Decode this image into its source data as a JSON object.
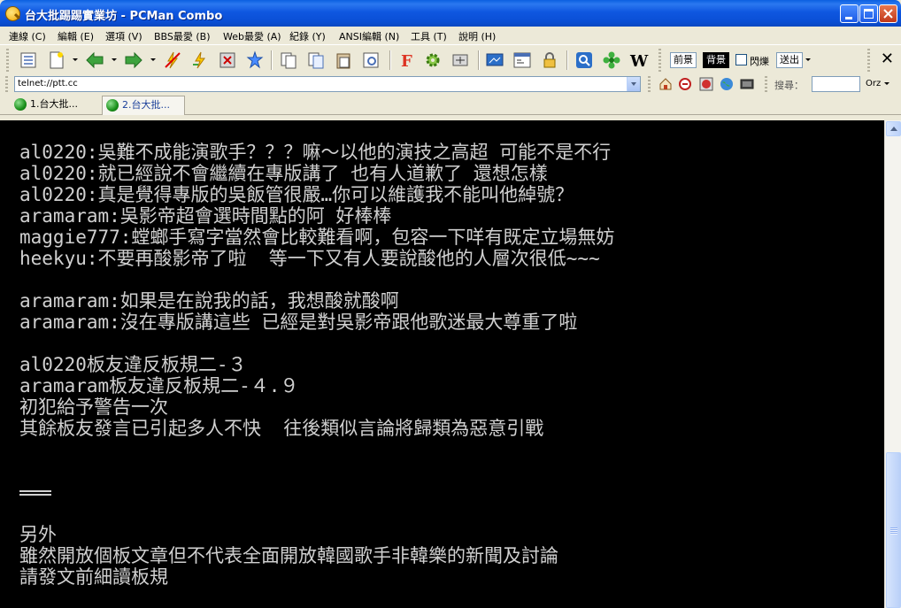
{
  "window": {
    "title": "台大批踢踢實業坊 - PCMan Combo"
  },
  "menu": [
    "連線 (C)",
    "編輯 (E)",
    "選項 (V)",
    "BBS最愛 (B)",
    "Web最愛 (A)",
    "紀錄 (Y)",
    "ANSI編輯 (N)",
    "工具 (T)",
    "說明 (H)"
  ],
  "toolbar": {
    "foreground_label": "前景",
    "background_label": "背景",
    "blink_label": "閃爍",
    "send_label": "送出",
    "close_label": "✕"
  },
  "address": {
    "url": "telnet://ptt.cc",
    "search_label": "搜尋：",
    "search_value": "",
    "engine_label": "Orz"
  },
  "tabs": [
    {
      "label": "1.台大批...",
      "active": false
    },
    {
      "label": "2.台大批...",
      "active": true
    }
  ],
  "terminal": {
    "lines": [
      "al0220:吳難不成能演歌手？？？嘛～以他的演技之高超 可能不是不行",
      "al0220:就已經說不會繼續在專版講了 也有人道歉了 還想怎樣",
      "al0220:真是覺得專版的吳飯管很嚴…你可以維護我不能叫他綽號？",
      "aramaram:吳影帝超會選時間點的阿 好棒棒",
      "maggie777:螳螂手寫字當然會比較難看啊，包容一下咩有既定立場無妨",
      "heekyu:不要再酸影帝了啦  等一下又有人要說酸他的人層次很低~~~",
      "",
      "aramaram:如果是在說我的話，我想酸就酸啊",
      "aramaram:沒在專版講這些 已經是對吳影帝跟他歌迷最大尊重了啦",
      "",
      "al0220板友違反板規二-３",
      "aramaram板友違反板規二-４.９",
      "初犯給予警告一次",
      "其餘板友發言已引起多人不快  往後類似言論將歸類為惡意引戰",
      "",
      "",
      "",
      "",
      "另外",
      "雖然開放個板文章但不代表全面開放韓國歌手非韓樂的新聞及討論",
      "請發文前細讀板規"
    ]
  },
  "colors": {
    "title_bar": "#0a4fd6",
    "terminal_bg": "#000000",
    "terminal_fg": "#d0d0d0",
    "chrome": "#ece9d8"
  }
}
